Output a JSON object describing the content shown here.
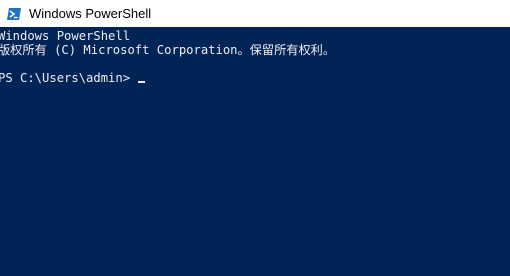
{
  "window": {
    "title": "Windows PowerShell",
    "icon": "powershell-icon"
  },
  "console": {
    "banner_line": "Windows PowerShell",
    "copyright_line": "版权所有 (C) Microsoft Corporation。保留所有权利。",
    "prompt": "PS C:\\Users\\admin> "
  },
  "colors": {
    "console_background": "#012456",
    "console_text": "#eeedf0",
    "titlebar_background": "#ffffff"
  }
}
